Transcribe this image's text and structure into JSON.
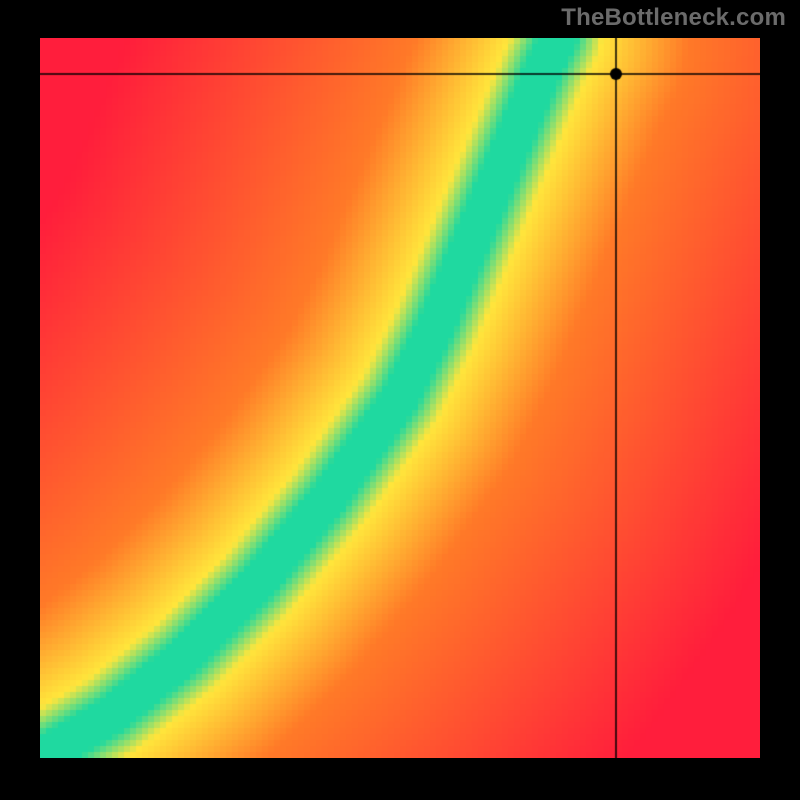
{
  "watermark": "TheBottleneck.com",
  "chart_data": {
    "type": "heatmap",
    "title": "",
    "xlabel": "",
    "ylabel": "",
    "xlim": [
      0,
      100
    ],
    "ylim": [
      0,
      100
    ],
    "colormap_note": "value 0 = red, 50 = yellow/orange, 100 = green; smooth gradient",
    "optimal_curve_description": "Narrow green band of near-zero bottleneck running from bottom-left to upper-center; surroundings fade yellow→orange→red with distance from the band.",
    "optimal_curve_points": [
      {
        "x": 0,
        "y": 0
      },
      {
        "x": 10,
        "y": 6
      },
      {
        "x": 20,
        "y": 14
      },
      {
        "x": 30,
        "y": 24
      },
      {
        "x": 40,
        "y": 36
      },
      {
        "x": 50,
        "y": 50
      },
      {
        "x": 55,
        "y": 60
      },
      {
        "x": 60,
        "y": 72
      },
      {
        "x": 65,
        "y": 84
      },
      {
        "x": 70,
        "y": 96
      },
      {
        "x": 72,
        "y": 100
      }
    ],
    "crosshair": {
      "x": 80,
      "y": 95
    },
    "marker": {
      "x": 80,
      "y": 95
    },
    "resolution": 120
  },
  "colors": {
    "red": "#ff1e3c",
    "orange": "#ff7a28",
    "yellow": "#ffe63c",
    "green": "#1fd9a0",
    "crosshair": "#000000",
    "marker": "#000000"
  }
}
